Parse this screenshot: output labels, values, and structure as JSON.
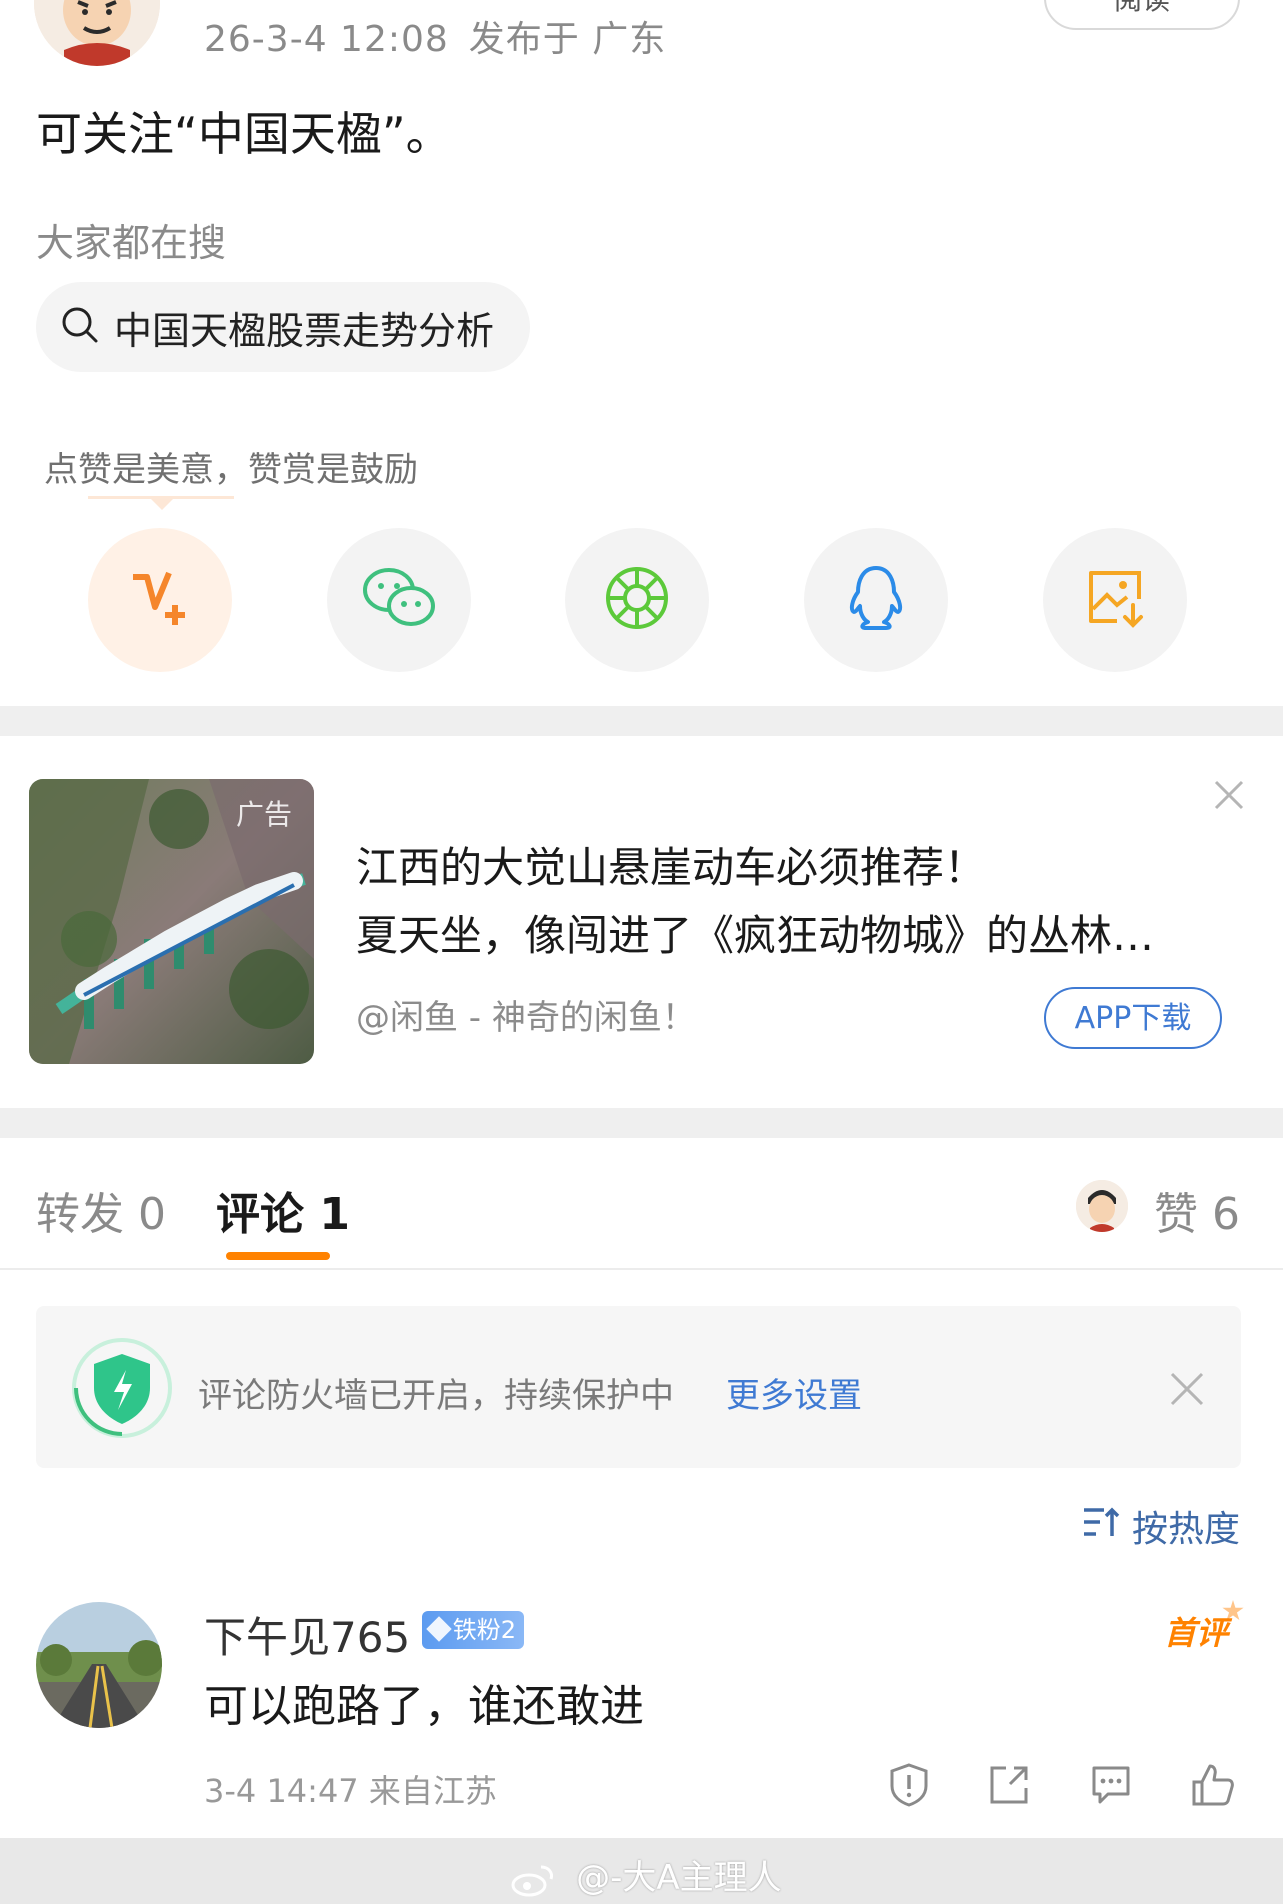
{
  "post": {
    "timestamp": "26-3-4 12:08",
    "location": "发布于 广东",
    "read_button": "阅读",
    "text": "可关注“中国天楹”。"
  },
  "search": {
    "label": "大家都在搜",
    "query": "中国天楹股票走势分析"
  },
  "reward": {
    "hint": "点赞是美意，赞赏是鼓励"
  },
  "share_icons": [
    "v-plus-icon",
    "wechat-icon",
    "moments-icon",
    "qq-icon",
    "save-image-icon"
  ],
  "ad": {
    "tag": "广告",
    "title_line1": "江西的大觉山悬崖动车必须推荐！",
    "title_line2": "夏天坐，像闯进了《疯狂动物城》的丛林…",
    "source": "@闲鱼 - 神奇的闲鱼！",
    "download_label": "APP下载"
  },
  "tabs": {
    "forward": "转发 0",
    "comment": "评论 1",
    "like": "赞 6"
  },
  "firewall": {
    "text": "评论防火墙已开启，持续保护中",
    "link": "更多设置"
  },
  "sort": {
    "label": "按热度"
  },
  "comment": {
    "username": "下午见765",
    "badge": "铁粉2",
    "first_label": "首评",
    "text": "可以跑路了，谁还敢进",
    "time": "3-4 14:47 来自江苏"
  },
  "watermark": {
    "text": "@-大A主理人"
  },
  "colors": {
    "accent_orange": "#ff8200",
    "link_blue": "#3f7ad3",
    "wechat_green": "#3fc07e",
    "moments_green": "#5cc93a",
    "qq_blue": "#2b8be8",
    "save_orange": "#f5a623"
  }
}
